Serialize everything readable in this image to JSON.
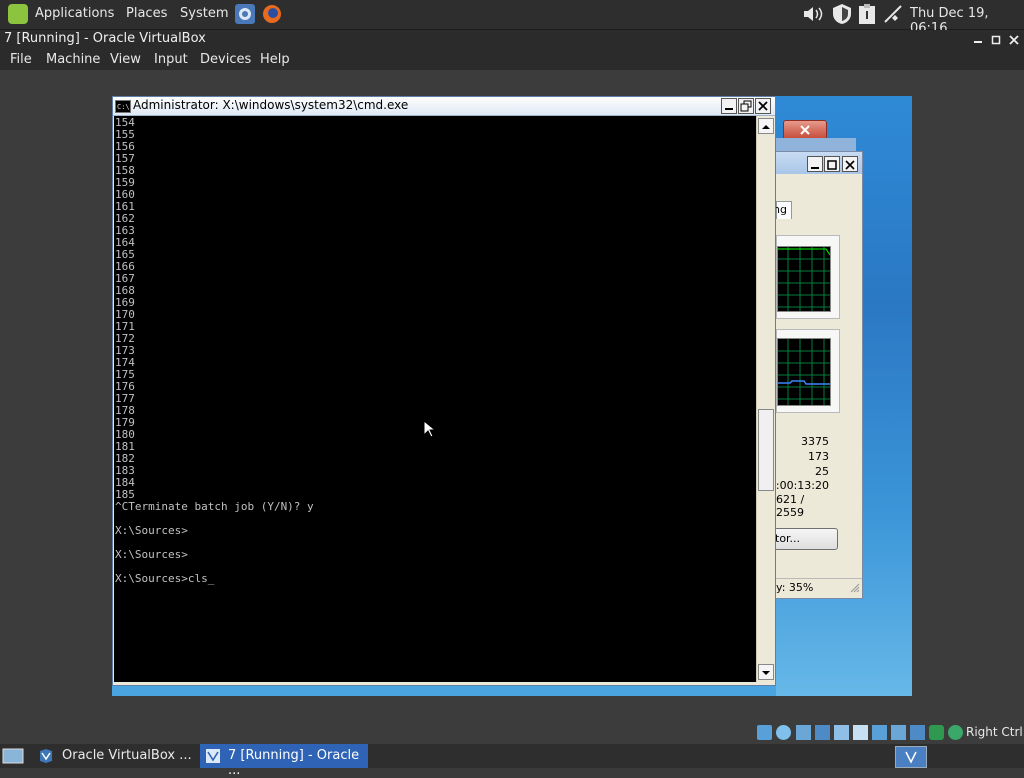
{
  "top_panel": {
    "applications": "Applications",
    "places": "Places",
    "system": "System",
    "clock": "Thu Dec 19, 06:16",
    "tray_icons": [
      "volume-icon",
      "shield-icon",
      "clipboard-icon",
      "network-icon"
    ]
  },
  "window": {
    "title": "7 [Running] - Oracle VirtualBox",
    "menu": [
      "File",
      "Machine",
      "View",
      "Input",
      "Devices",
      "Help"
    ]
  },
  "cmd": {
    "title": "Administrator: X:\\windows\\system32\\cmd.exe",
    "lines": [
      "154",
      "155",
      "156",
      "157",
      "158",
      "159",
      "160",
      "161",
      "162",
      "163",
      "164",
      "165",
      "166",
      "167",
      "168",
      "169",
      "170",
      "171",
      "172",
      "173",
      "174",
      "175",
      "176",
      "177",
      "178",
      "179",
      "180",
      "181",
      "182",
      "183",
      "184",
      "185",
      "^CTerminate batch job (Y/N)? y",
      "",
      "X:\\Sources>",
      "",
      "X:\\Sources>",
      "",
      "X:\\Sources>cls_"
    ]
  },
  "taskmgr": {
    "tab_fragment": "ng",
    "values": [
      "3375",
      "173",
      "25",
      ":00:13:20",
      "621 / 2559"
    ],
    "button_fragment": "tor...",
    "status_fragment": "y: 35%"
  },
  "statusbar": {
    "host_key": "Right Ctrl"
  },
  "taskbar": {
    "items": [
      "Oracle VirtualBox ...",
      "7 [Running] - Oracle ..."
    ]
  },
  "colors": {
    "panel": "#2e2e2e",
    "console_bg": "#000000",
    "console_text": "#c0c0c0",
    "active_task": "#2f63b5",
    "guest_desktop": "#2f8ad6"
  }
}
